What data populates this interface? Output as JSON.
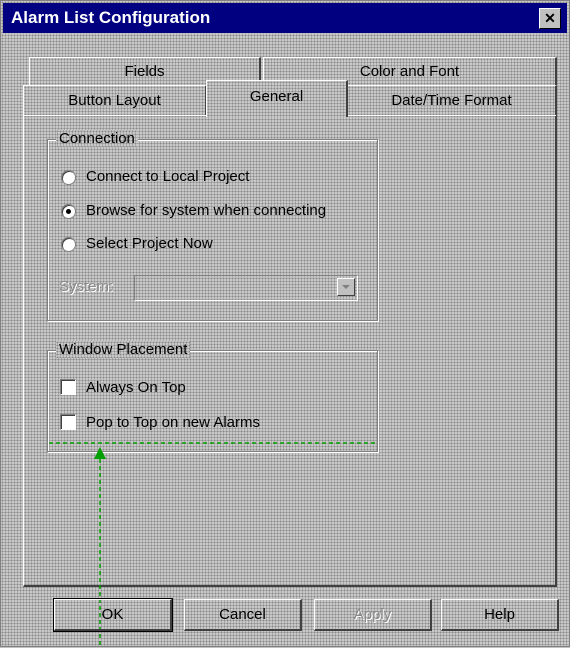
{
  "window": {
    "title": "Alarm List Configuration",
    "close_glyph": "✕"
  },
  "tabs": {
    "back_row": [
      "Fields",
      "Color and Font"
    ],
    "front_row": [
      "Button Layout",
      "General",
      "Date/Time Format"
    ],
    "active": "General"
  },
  "connection": {
    "title": "Connection",
    "options": [
      {
        "label": "Connect to Local Project",
        "selected": false
      },
      {
        "label": "Browse for system when connecting",
        "selected": true
      },
      {
        "label": "Select Project Now",
        "selected": false
      }
    ],
    "system_label": "System:",
    "system_value": ""
  },
  "window_placement": {
    "title": "Window Placement",
    "options": [
      {
        "label": "Always On Top",
        "checked": false
      },
      {
        "label": "Pop to Top on new Alarms",
        "checked": false
      }
    ]
  },
  "buttons": {
    "ok": "OK",
    "cancel": "Cancel",
    "apply": "Apply",
    "help": "Help"
  },
  "colors": {
    "title_bar": "#000080",
    "annotation": "#00a000"
  }
}
